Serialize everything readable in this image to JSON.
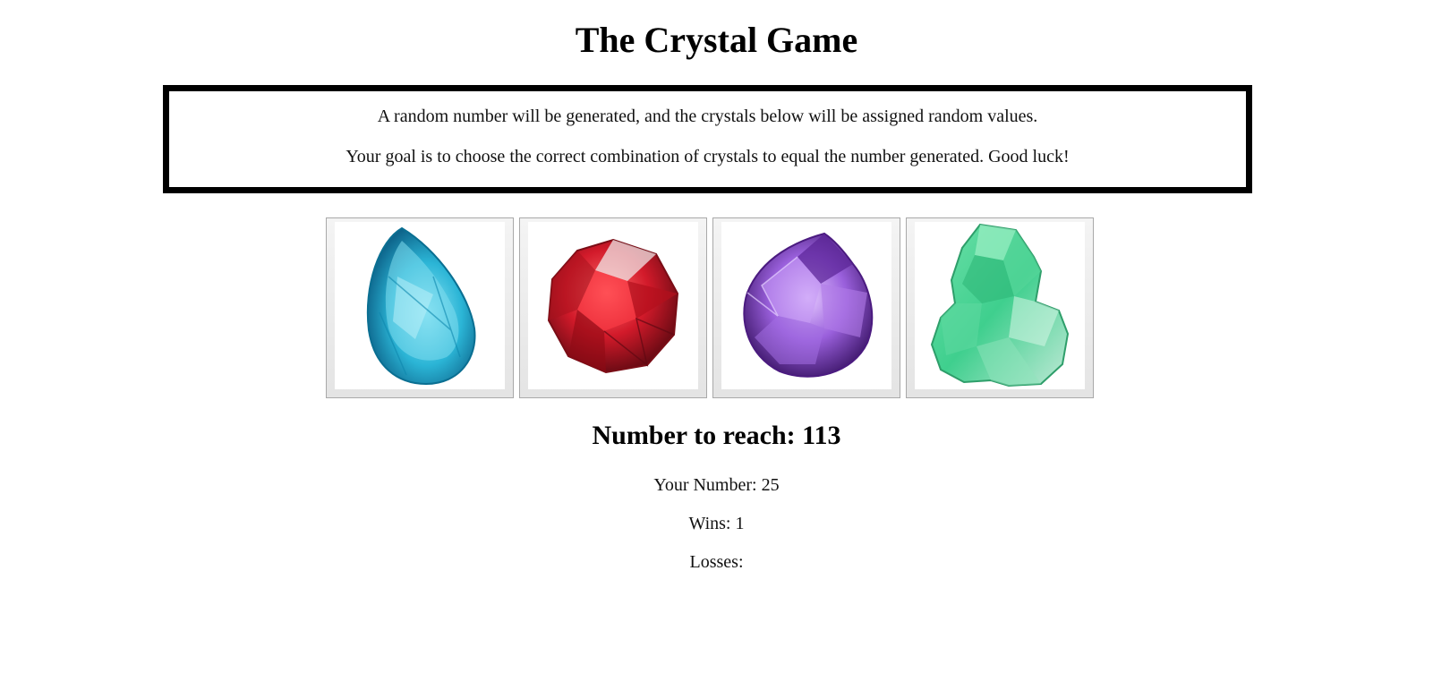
{
  "title": "The Crystal Game",
  "instructions": {
    "line1": "A random number will be generated, and the crystals below will be assigned random values.",
    "line2": "Your goal is to choose the correct combination of crystals to equal the number generated. Good luck!"
  },
  "crystals": [
    {
      "name": "blue",
      "color": "#2bb5d6"
    },
    {
      "name": "red",
      "color": "#d21a2a"
    },
    {
      "name": "purple",
      "color": "#8a4fd0"
    },
    {
      "name": "green",
      "color": "#3fcf8e"
    }
  ],
  "target": {
    "label": "Number to reach:",
    "value": "113"
  },
  "your_number": {
    "label": "Your Number:",
    "value": "25"
  },
  "wins": {
    "label": "Wins:",
    "value": "1"
  },
  "losses": {
    "label": "Losses:",
    "value": ""
  }
}
